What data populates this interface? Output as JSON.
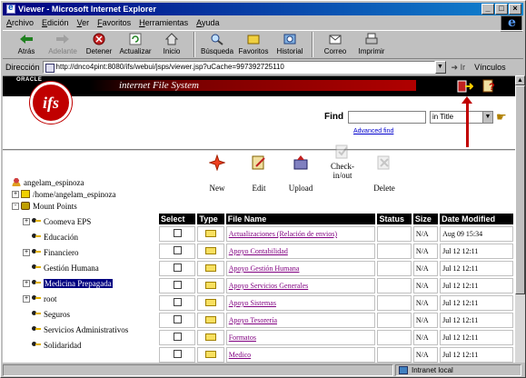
{
  "window": {
    "title": "Viewer - Microsoft Internet Explorer",
    "controls": [
      "_",
      "□",
      "×"
    ]
  },
  "menu": [
    "Archivo",
    "Edición",
    "Ver",
    "Favoritos",
    "Herramientas",
    "Ayuda"
  ],
  "toolbar": {
    "buttons": [
      {
        "label": "Atrás",
        "icon": "back-arrow-icon"
      },
      {
        "label": "Adelante",
        "icon": "forward-arrow-icon",
        "disabled": true
      },
      {
        "label": "Detener",
        "icon": "stop-icon"
      },
      {
        "label": "Actualizar",
        "icon": "refresh-icon"
      },
      {
        "label": "Inicio",
        "icon": "home-icon"
      },
      {
        "label": "Búsqueda",
        "icon": "search-icon"
      },
      {
        "label": "Favoritos",
        "icon": "favorites-icon"
      },
      {
        "label": "Historial",
        "icon": "history-icon"
      },
      {
        "label": "Correo",
        "icon": "mail-icon"
      },
      {
        "label": "Imprimir",
        "icon": "print-icon"
      }
    ]
  },
  "address": {
    "label": "Dirección",
    "url": "http://dnco4pint:8080/ifs/webui/jsps/viewer.jsp?uCache=997392725110",
    "go_label": "Ir",
    "links_label": "Vínculos"
  },
  "app": {
    "vendor": "ORACLE",
    "logo_text": "ifs",
    "title": "internet File System",
    "find_label": "Find",
    "find_value": "",
    "find_scope": "in Title",
    "advanced_find": "Advanced find"
  },
  "tree": [
    {
      "label": "angelam_espinoza",
      "icon": "person",
      "expander": ""
    },
    {
      "label": "/home/angelam_espinoza",
      "icon": "folder",
      "expander": "+"
    },
    {
      "label": "Mount Points",
      "icon": "mount",
      "expander": "-"
    },
    {
      "label": "Coomeva EPS",
      "icon": "key",
      "expander": "+"
    },
    {
      "label": "Educación",
      "icon": "key",
      "expander": ""
    },
    {
      "label": "Financiero",
      "icon": "key",
      "expander": "+"
    },
    {
      "label": "Gestión Humana",
      "icon": "key",
      "expander": ""
    },
    {
      "label": "Medicina Prepagada",
      "icon": "key",
      "expander": "+",
      "selected": true
    },
    {
      "label": "root",
      "icon": "key",
      "expander": "+"
    },
    {
      "label": "Seguros",
      "icon": "key",
      "expander": ""
    },
    {
      "label": "Servicios Administrativos",
      "icon": "key",
      "expander": ""
    },
    {
      "label": "Solidaridad",
      "icon": "key",
      "expander": ""
    }
  ],
  "actions": [
    {
      "label": "New",
      "icon": "new-icon"
    },
    {
      "label": "Edit",
      "icon": "edit-icon"
    },
    {
      "label": "Upload",
      "icon": "upload-icon"
    },
    {
      "label": "Check-in/out",
      "icon": "checkinout-icon",
      "disabled": true
    },
    {
      "label": "Delete",
      "icon": "delete-icon",
      "disabled": true
    }
  ],
  "table": {
    "headers": [
      "Select",
      "Type",
      "File Name",
      "Status",
      "Size",
      "Date Modified"
    ],
    "rows": [
      {
        "name": "Actualizaciones (Relación de envios)",
        "status": "",
        "size": "N/A",
        "date": "Aug 09 15:34"
      },
      {
        "name": "Apoyo Contabilidad",
        "status": "",
        "size": "N/A",
        "date": "Jul 12 12:11"
      },
      {
        "name": "Apoyo Gestión Humana",
        "status": "",
        "size": "N/A",
        "date": "Jul 12 12:11"
      },
      {
        "name": "Apoyo Servicios Generales",
        "status": "",
        "size": "N/A",
        "date": "Jul 12 12:11"
      },
      {
        "name": "Apoyo Sistemas",
        "status": "",
        "size": "N/A",
        "date": "Jul 12 12:11"
      },
      {
        "name": "Apoyo Tesorería",
        "status": "",
        "size": "N/A",
        "date": "Jul 12 12:11"
      },
      {
        "name": "Formatos",
        "status": "",
        "size": "N/A",
        "date": "Jul 12 12:11"
      },
      {
        "name": "Medico",
        "status": "",
        "size": "N/A",
        "date": "Jul 12 12:11"
      }
    ]
  },
  "status": {
    "zone": "Intranet local"
  }
}
